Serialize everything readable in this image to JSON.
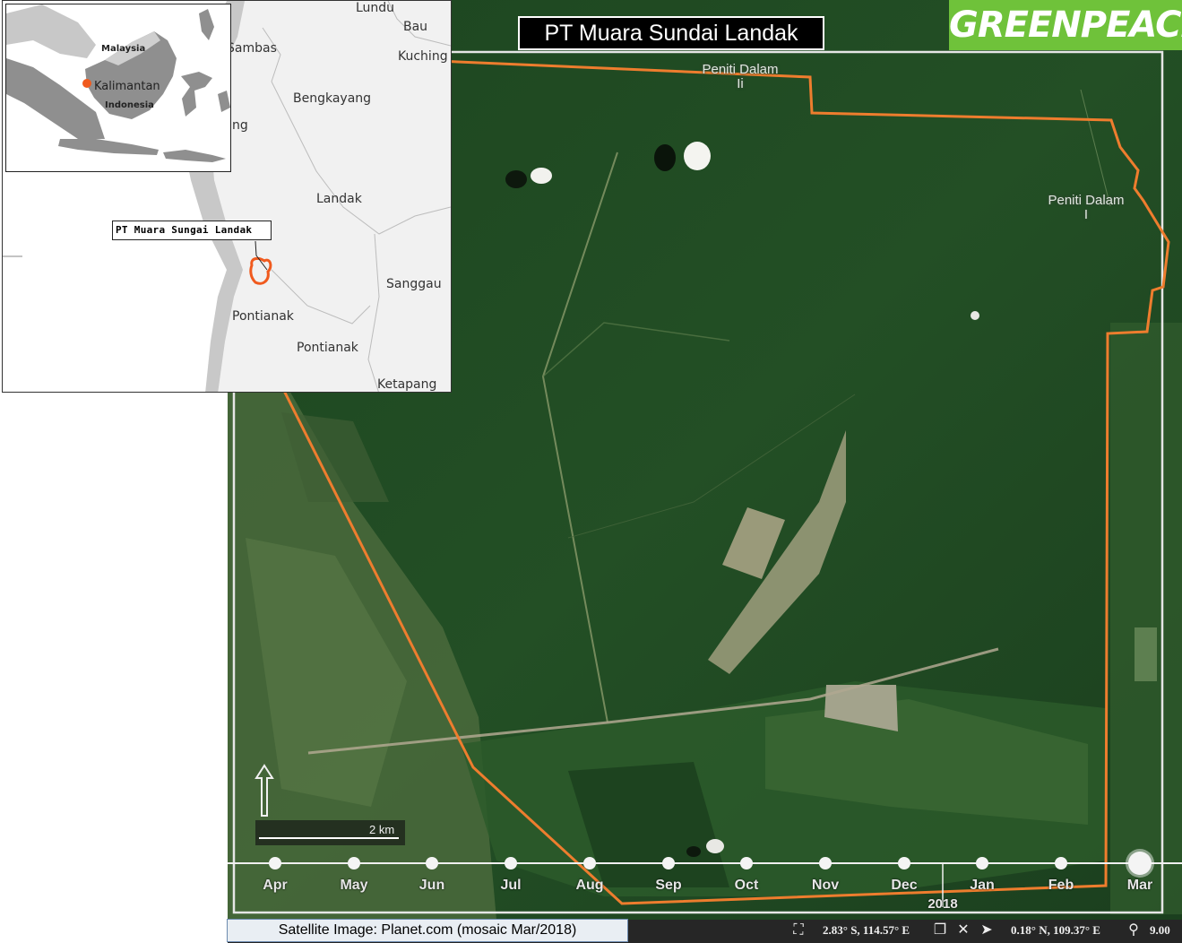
{
  "title": "PT Muara Sundai Landak",
  "logo_text": "GREENPEACE",
  "satellite_labels": [
    {
      "text": "Peniti Dalam\nIi",
      "name": "peniti-dalam-ii-label"
    },
    {
      "text": "Peniti Dalam\nI",
      "name": "peniti-dalam-i-label"
    }
  ],
  "locator": {
    "places": [
      "Lundu",
      "Bau",
      "Sambas",
      "Kuching",
      "Bengkayang",
      "ng",
      "Landak",
      "Sanggau",
      "Pontianak",
      "Pontianak",
      "Ketapang"
    ],
    "callout": "PT Muara Sungai Landak",
    "inset": {
      "labels": [
        "Malaysia",
        "Kalimantan",
        "Indonesia"
      ]
    }
  },
  "timeline": {
    "months": [
      "Apr",
      "May",
      "Jun",
      "Jul",
      "Aug",
      "Sep",
      "Oct",
      "Nov",
      "Dec",
      "Jan",
      "Feb",
      "Mar"
    ],
    "year": "2018",
    "selected": "Mar"
  },
  "scale_bar": "2 km",
  "caption": "Satellite Image: Planet.com (mosaic Mar/2018)",
  "coords": {
    "cursor": "2.83° S, 114.57° E",
    "center": "0.18° N, 109.37° E",
    "zoom": "9.00"
  },
  "colors": {
    "boundary": "#ee7d2e",
    "logo_bg": "#6fc23a",
    "forest": "#1f4a22"
  }
}
